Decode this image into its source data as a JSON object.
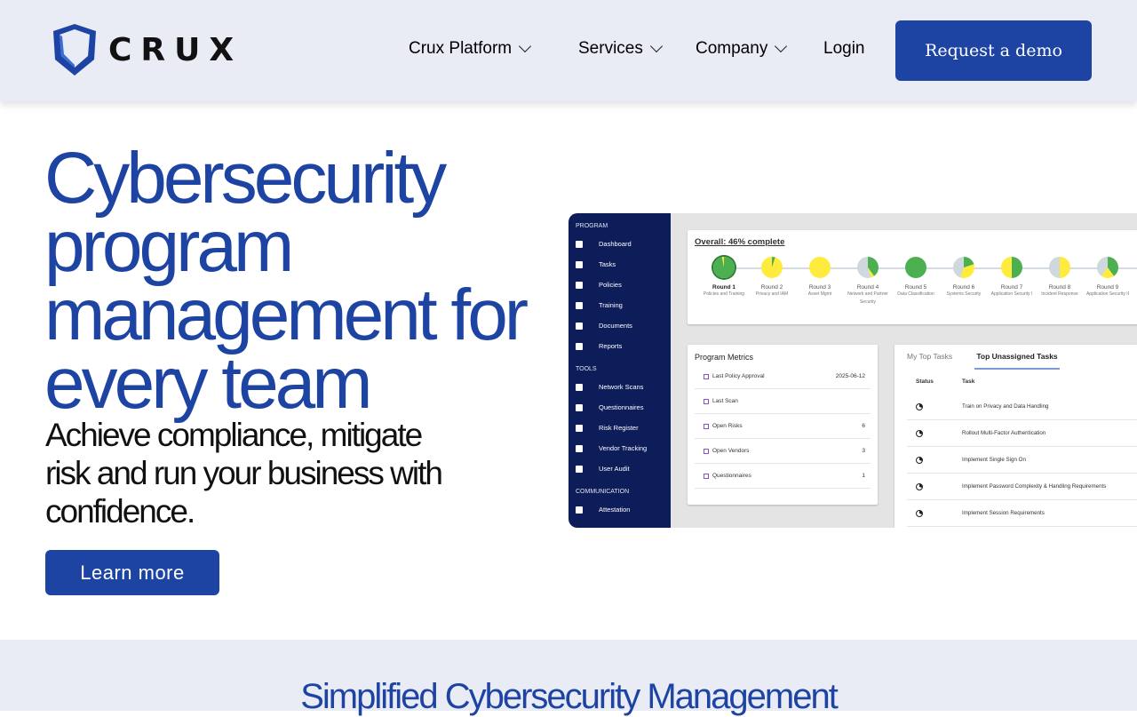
{
  "brand": {
    "name": "CRUX",
    "accent": "#1e44a3"
  },
  "nav": {
    "items": [
      {
        "label": "Crux Platform",
        "dropdown": true
      },
      {
        "label": "Services",
        "dropdown": true
      },
      {
        "label": "Company",
        "dropdown": true
      },
      {
        "label": "Login",
        "dropdown": false
      }
    ],
    "cta": "Request a demo"
  },
  "hero": {
    "title": "Cybersecurity program management for every team",
    "subtitle": "Achieve compliance, mitigate risk and run your business with confidence.",
    "button": "Learn more"
  },
  "dashboard": {
    "sidebar": {
      "sections": [
        {
          "label": "PROGRAM",
          "items": [
            "Dashboard",
            "Tasks",
            "Policies",
            "Training",
            "Documents",
            "Reports"
          ]
        },
        {
          "label": "TOOLS",
          "items": [
            "Network Scans",
            "Questionnaires",
            "Risk Register",
            "Vendor Tracking",
            "User Audit"
          ]
        },
        {
          "label": "COMMUNICATION",
          "items": [
            "Attestation"
          ]
        }
      ]
    },
    "overall": "Overall: 46% complete",
    "rounds": [
      {
        "name": "Round 1",
        "desc": "Policies and Training",
        "green": 97,
        "yellow": 3,
        "gray": 0
      },
      {
        "name": "Round 2",
        "desc": "Privacy and IAM",
        "green": 5,
        "yellow": 95,
        "gray": 0
      },
      {
        "name": "Round 3",
        "desc": "Asset Mgmt",
        "green": 0,
        "yellow": 100,
        "gray": 0
      },
      {
        "name": "Round 4",
        "desc": "Network and Partner Security",
        "green": 40,
        "yellow": 5,
        "gray": 55
      },
      {
        "name": "Round 5",
        "desc": "Data Classification",
        "green": 100,
        "yellow": 0,
        "gray": 0
      },
      {
        "name": "Round 6",
        "desc": "Systems Security",
        "green": 20,
        "yellow": 35,
        "gray": 45
      },
      {
        "name": "Round 7",
        "desc": "Application Security I",
        "green": 50,
        "yellow": 50,
        "gray": 0
      },
      {
        "name": "Round 8",
        "desc": "Incident Response",
        "green": 0,
        "yellow": 50,
        "gray": 50
      },
      {
        "name": "Round 9",
        "desc": "Application Security II",
        "green": 40,
        "yellow": 20,
        "gray": 40
      }
    ],
    "colors": {
      "green": "#4caf50",
      "yellow": "#ffeb3b",
      "gray": "#cfd8dc"
    },
    "metrics": {
      "title": "Program Metrics",
      "rows": [
        {
          "label": "Last Policy Approval",
          "value": "2025-06-12"
        },
        {
          "label": "Last Scan",
          "value": ""
        },
        {
          "label": "Open Risks",
          "value": "6"
        },
        {
          "label": "Open Vendors",
          "value": "3"
        },
        {
          "label": "Questionnaires",
          "value": "1"
        }
      ]
    },
    "tasks": {
      "tabs": [
        "My Top Tasks",
        "Top Unassigned Tasks"
      ],
      "active_tab": 1,
      "columns": [
        "Status",
        "Task"
      ],
      "rows": [
        "Train on Privacy and Data Handling",
        "Rollout Multi-Factor Authentication",
        "Implement Single Sign On",
        "Implement Password Complexity & Handling Requirements",
        "Implement Session Requirements"
      ]
    }
  },
  "section2": {
    "title": "Simplified Cybersecurity Management"
  }
}
